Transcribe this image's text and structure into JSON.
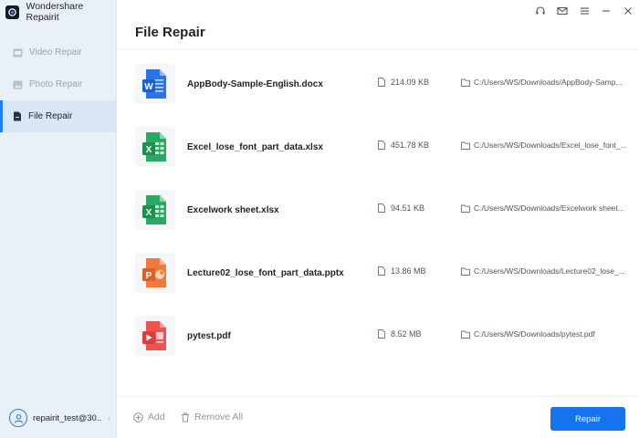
{
  "app": {
    "title": "Wondershare Repairit"
  },
  "sidebar": {
    "items": [
      {
        "label": "Video Repair",
        "icon": "film-icon",
        "active": false
      },
      {
        "label": "Photo Repair",
        "icon": "image-icon",
        "active": false
      },
      {
        "label": "File Repair",
        "icon": "document-icon",
        "active": true
      }
    ],
    "user": {
      "name": "repairit_test@30..."
    }
  },
  "header": {
    "title": "File Repair"
  },
  "window_controls": [
    "headset-icon",
    "mail-icon",
    "menu-icon",
    "minimize-icon",
    "close-icon"
  ],
  "files": [
    {
      "name": "AppBody-Sample-English.docx",
      "size": "214.09  KB",
      "path": "C:/Users/WS/Downloads/AppBody-Samp...",
      "type": "word"
    },
    {
      "name": "Excel_lose_font_part_data.xlsx",
      "size": "451.78  KB",
      "path": "C:/Users/WS/Downloads/Excel_lose_font_...",
      "type": "excel"
    },
    {
      "name": "Excelwork sheet.xlsx",
      "size": "94.51  KB",
      "path": "C:/Users/WS/Downloads/Excelwork sheet...",
      "type": "excel"
    },
    {
      "name": "Lecture02_lose_font_part_data.pptx",
      "size": "13.86  MB",
      "path": "C:/Users/WS/Downloads/Lecture02_lose_...",
      "type": "powerpoint"
    },
    {
      "name": "pytest.pdf",
      "size": "8.52  MB",
      "path": "C:/Users/WS/Downloads/pytest.pdf",
      "type": "pdf"
    }
  ],
  "footer": {
    "add_label": "Add",
    "remove_all_label": "Remove All",
    "repair_label": "Repair"
  },
  "colors": {
    "accent": "#1673f0",
    "word": "#2b74e8",
    "excel": "#2ba863",
    "powerpoint": "#f07a3a",
    "pdf": "#ef5350"
  }
}
